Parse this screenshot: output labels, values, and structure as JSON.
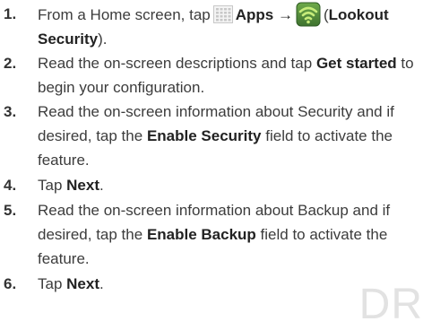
{
  "watermark": "DR",
  "steps": [
    {
      "number": "1.",
      "parts": {
        "a": "From a Home screen, tap",
        "b": "Apps",
        "c": "→",
        "d": "(",
        "e": "Lookout Security",
        "f": ")."
      },
      "icons": [
        "apps-grid-icon",
        "lookout-shield-icon"
      ],
      "colors": {
        "lookout_bg": "#4f8a3a",
        "lookout_wave": "#b8e070",
        "apps_grid": "#c8c8c8"
      }
    },
    {
      "number": "2.",
      "parts": {
        "a": "Read the on-screen descriptions and tap",
        "b": "Get started",
        "c": "to begin your configuration."
      }
    },
    {
      "number": "3.",
      "parts": {
        "a": "Read the on-screen information about Security and if desired, tap the",
        "b": "Enable Security",
        "c": "field to activate the feature."
      }
    },
    {
      "number": "4.",
      "parts": {
        "a": "Tap",
        "b": "Next",
        "c": "."
      }
    },
    {
      "number": "5.",
      "parts": {
        "a": "Read the on-screen information about Backup and if desired, tap the",
        "b": "Enable Backup",
        "c": "field to activate the feature."
      }
    },
    {
      "number": "6.",
      "parts": {
        "a": "Tap",
        "b": "Next",
        "c": "."
      }
    }
  ]
}
